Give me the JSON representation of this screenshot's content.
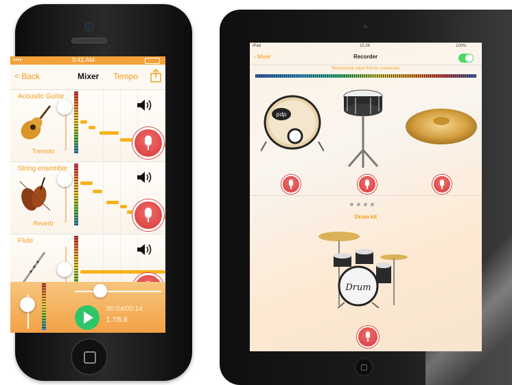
{
  "iphone": {
    "status": {
      "time": "9:41 AM",
      "signal": "••••"
    },
    "nav": {
      "back": "< Back",
      "title": "Mixer",
      "tempo": "Tempo"
    },
    "tracks": [
      {
        "name": "Acoustic Guitar",
        "effect": "Tremolo",
        "volume": 0.75
      },
      {
        "name": "String ensemble",
        "effect": "Reverb",
        "volume": 0.7
      },
      {
        "name": "Flute",
        "effect": "",
        "volume": 0.5
      }
    ],
    "player": {
      "time": "00:04/00:14",
      "ratio": "1.7/5.8",
      "progress": 0.29
    }
  },
  "ipad": {
    "status": {
      "carrier": "iPad",
      "time": "15:26",
      "battery": "100%"
    },
    "nav": {
      "back": "Mixer",
      "title": "Recorder"
    },
    "subtitle": "Record your voice first for conversion",
    "instruments": [
      "bass-drum",
      "snare-drum",
      "cymbal"
    ],
    "page_dots": 4,
    "kit_label": "Drum kit",
    "toggle_on": true
  },
  "colors": {
    "accent": "#f49a1a",
    "record": "#d93838",
    "play": "#2ec56a",
    "toggle": "#4cd964"
  }
}
